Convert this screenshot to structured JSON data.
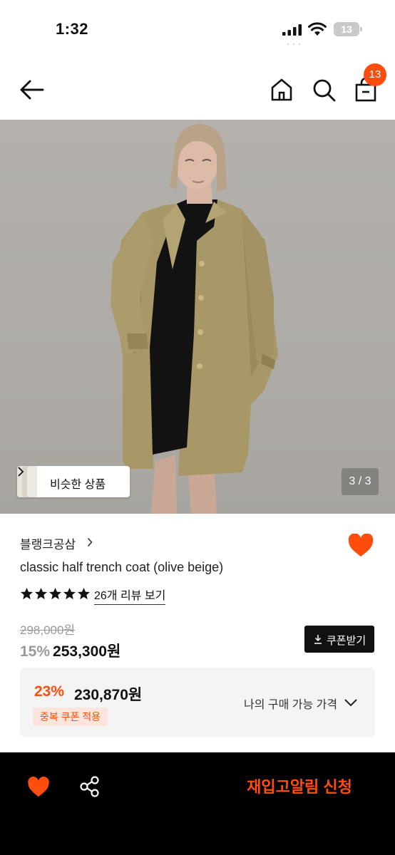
{
  "status_bar": {
    "time": "1:32",
    "battery_level": "13"
  },
  "header": {
    "cart_count": "13",
    "icons": [
      "back-arrow-icon",
      "home-icon",
      "search-icon",
      "shopping-bag-icon"
    ]
  },
  "gallery": {
    "similar_label": "비슷한 상품",
    "page_indicator": "3 / 3"
  },
  "product": {
    "brand": "블랭크공삼",
    "name": "classic half trench coat (olive beige)",
    "rating_stars": 5,
    "review_link": "26개 리뷰 보기",
    "original_price": "298,000원",
    "discount_rate": "15%",
    "sale_price": "253,300원",
    "coupon_label": "쿠폰받기",
    "liked": true
  },
  "benefit": {
    "rate": "23%",
    "price": "230,870원",
    "tag": "중복 쿠폰 적용",
    "toggle_label": "나의 구매 가능 가격"
  },
  "bottom_bar": {
    "restock_label": "재입고알림 신청"
  },
  "colors": {
    "accent": "#ff4d0d",
    "dark": "#000000",
    "muted": "#9a9a9a"
  }
}
